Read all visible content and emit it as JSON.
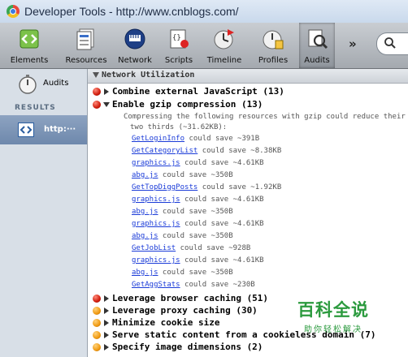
{
  "window": {
    "title": "Developer Tools - http://www.cnblogs.com/",
    "icon": "chrome-icon"
  },
  "toolbar": {
    "items": [
      {
        "label": "Elements",
        "icon": "elements-icon"
      },
      {
        "label": "Resources",
        "icon": "resources-icon"
      },
      {
        "label": "Network",
        "icon": "network-icon"
      },
      {
        "label": "Scripts",
        "icon": "scripts-icon"
      },
      {
        "label": "Timeline",
        "icon": "timeline-icon"
      },
      {
        "label": "Profiles",
        "icon": "profiles-icon"
      },
      {
        "label": "Audits",
        "icon": "audits-icon",
        "active": true
      }
    ],
    "overflow_label": "»",
    "search_icon": "search-icon"
  },
  "sidebar": {
    "audits_label": "Audits",
    "results_header": "RESULTS",
    "result_item_label": "http:···"
  },
  "panel": {
    "header": "Network Utilization",
    "rules": [
      {
        "title": "Combine external JavaScript (13)",
        "severity": "red",
        "expanded": false
      },
      {
        "title": "Enable gzip compression (13)",
        "severity": "red",
        "expanded": true,
        "description_line1": "Compressing the following resources with gzip could reduce their transfer size by about",
        "description_line2": "two thirds (~31.62KB):",
        "resources": [
          {
            "name": "GetLoginInfo",
            "saving": " could save ~391B"
          },
          {
            "name": "GetCategoryList",
            "saving": " could save ~8.38KB"
          },
          {
            "name": "graphics.js",
            "saving": " could save ~4.61KB"
          },
          {
            "name": "abg.js",
            "saving": " could save ~350B"
          },
          {
            "name": "GetTopDiggPosts",
            "saving": " could save ~1.92KB"
          },
          {
            "name": "graphics.js",
            "saving": " could save ~4.61KB"
          },
          {
            "name": "abg.js",
            "saving": " could save ~350B"
          },
          {
            "name": "graphics.js",
            "saving": " could save ~4.61KB"
          },
          {
            "name": "abg.js",
            "saving": " could save ~350B"
          },
          {
            "name": "GetJobList",
            "saving": " could save ~928B"
          },
          {
            "name": "graphics.js",
            "saving": " could save ~4.61KB"
          },
          {
            "name": "abg.js",
            "saving": " could save ~350B"
          },
          {
            "name": "GetAggStats",
            "saving": " could save ~230B"
          }
        ]
      },
      {
        "title": "Leverage browser caching (51)",
        "severity": "red",
        "expanded": false
      },
      {
        "title": "Leverage proxy caching (30)",
        "severity": "orange",
        "expanded": false
      },
      {
        "title": "Minimize cookie size",
        "severity": "orange",
        "expanded": false
      },
      {
        "title": "Serve static content from a cookieless domain (7)",
        "severity": "orange",
        "expanded": false
      },
      {
        "title": "Specify image dimensions (2)",
        "severity": "orange",
        "expanded": false
      }
    ]
  },
  "watermark": {
    "big": "百科全说",
    "small": "助你轻松解决"
  },
  "colors": {
    "red": "#d01c0c",
    "orange": "#f09a12",
    "link": "#1a3bd8",
    "accent": "#2b9a3e"
  }
}
